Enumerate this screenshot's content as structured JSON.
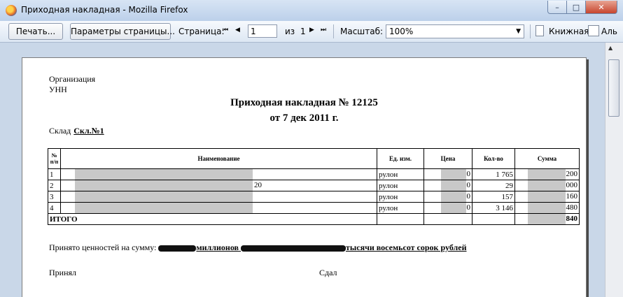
{
  "window": {
    "title": "Приходная накладная - Mozilla Firefox",
    "minimize_glyph": "–",
    "maximize_glyph": "□",
    "close_glyph": "✕"
  },
  "toolbar": {
    "print_label": "Печать...",
    "page_setup_label": "Параметры страницы...",
    "page_label": "Страница:",
    "page_value": "1",
    "of_label": "из",
    "page_total": "1",
    "zoom_label": "Масштаб:",
    "zoom_value": "100%",
    "portrait_label": "Книжная",
    "landscape_label": "Аль"
  },
  "document": {
    "organization_label": "Организация",
    "unn_label": "УНН",
    "title": "Приходная накладная № 12125",
    "date": "от 7 дек 2011 г.",
    "warehouse_label": "Склад",
    "warehouse_value": "Скл.№1",
    "table": {
      "headers": {
        "num": "№ п/п",
        "name": "Наименование",
        "unit": "Ед. изм.",
        "price": "Цена",
        "qty": "Кол-во",
        "sum": "Сумма"
      },
      "rows": [
        {
          "num": "1",
          "name": "",
          "unit": "рулон",
          "price": "0",
          "qty": "1 765",
          "sum": "200"
        },
        {
          "num": "2",
          "name": "20",
          "unit": "рулон",
          "price": "0",
          "qty": "29",
          "sum": "000"
        },
        {
          "num": "3",
          "name": "",
          "unit": "рулон",
          "price": "0",
          "qty": "157",
          "sum": "160"
        },
        {
          "num": "4",
          "name": "",
          "unit": "рулон",
          "price": "0",
          "qty": "3 146",
          "sum": "480"
        }
      ],
      "total_label": "ИТОГО",
      "total_sum": "840"
    },
    "accepted_sum_label": "Принято ценностей на сумму:",
    "accepted_sum_part1": "миллионов",
    "accepted_sum_part2": "тысячи восемьсот сорок рублей",
    "accepted_by_label": "Принял",
    "delivered_by_label": "Сдал"
  }
}
